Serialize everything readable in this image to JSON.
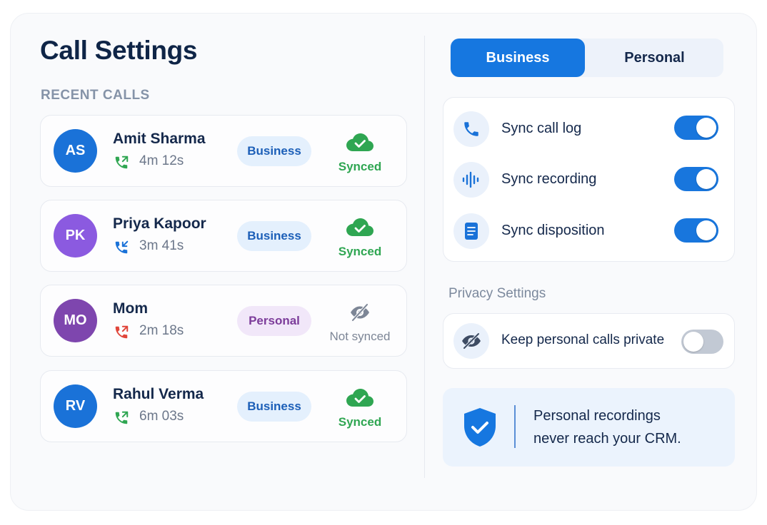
{
  "page": {
    "title": "Call Settings"
  },
  "recent_calls": {
    "heading": "RECENT CALLS",
    "items": [
      {
        "initials": "AS",
        "avatar_color": "#1a72d8",
        "name": "Amit Sharma",
        "direction": "outgoing",
        "direction_color": "#2fa652",
        "duration": "4m 12s",
        "tag": "Business",
        "sync_status": "Synced",
        "sync_icon": "cloud-check-icon"
      },
      {
        "initials": "PK",
        "avatar_color": "#8b5ae0",
        "name": "Priya Kapoor",
        "direction": "incoming",
        "direction_color": "#1a72d8",
        "duration": "3m 41s",
        "tag": "Business",
        "sync_status": "Synced",
        "sync_icon": "cloud-check-icon"
      },
      {
        "initials": "MO",
        "avatar_color": "#7e46ae",
        "name": "Mom",
        "direction": "outgoing",
        "direction_color": "#e0453a",
        "duration": "2m 18s",
        "tag": "Personal",
        "sync_status": "Not synced",
        "sync_icon": "eye-off-icon"
      },
      {
        "initials": "RV",
        "avatar_color": "#1a72d8",
        "name": "Rahul Verma",
        "direction": "outgoing",
        "direction_color": "#2fa652",
        "duration": "6m 03s",
        "tag": "Business",
        "sync_status": "Synced",
        "sync_icon": "cloud-check-icon"
      }
    ]
  },
  "mode_toggle": {
    "options": [
      "Business",
      "Personal"
    ],
    "selected": "Business"
  },
  "sync_settings": [
    {
      "label": "Sync call log",
      "icon": "phone-icon",
      "enabled": true
    },
    {
      "label": "Sync recording",
      "icon": "waveform-icon",
      "enabled": true
    },
    {
      "label": "Sync disposition",
      "icon": "document-icon",
      "enabled": true
    }
  ],
  "privacy": {
    "heading": "Privacy Settings",
    "setting": {
      "label": "Keep personal calls private",
      "icon": "eye-off-icon",
      "enabled": false
    }
  },
  "notice": {
    "icon": "shield-check-icon",
    "line1": "Personal recordings",
    "line2": "never reach your CRM."
  },
  "colors": {
    "accent": "#1677e0",
    "success": "#2fa652",
    "personal": "#7c3c9a",
    "heading": "#0f2547"
  }
}
